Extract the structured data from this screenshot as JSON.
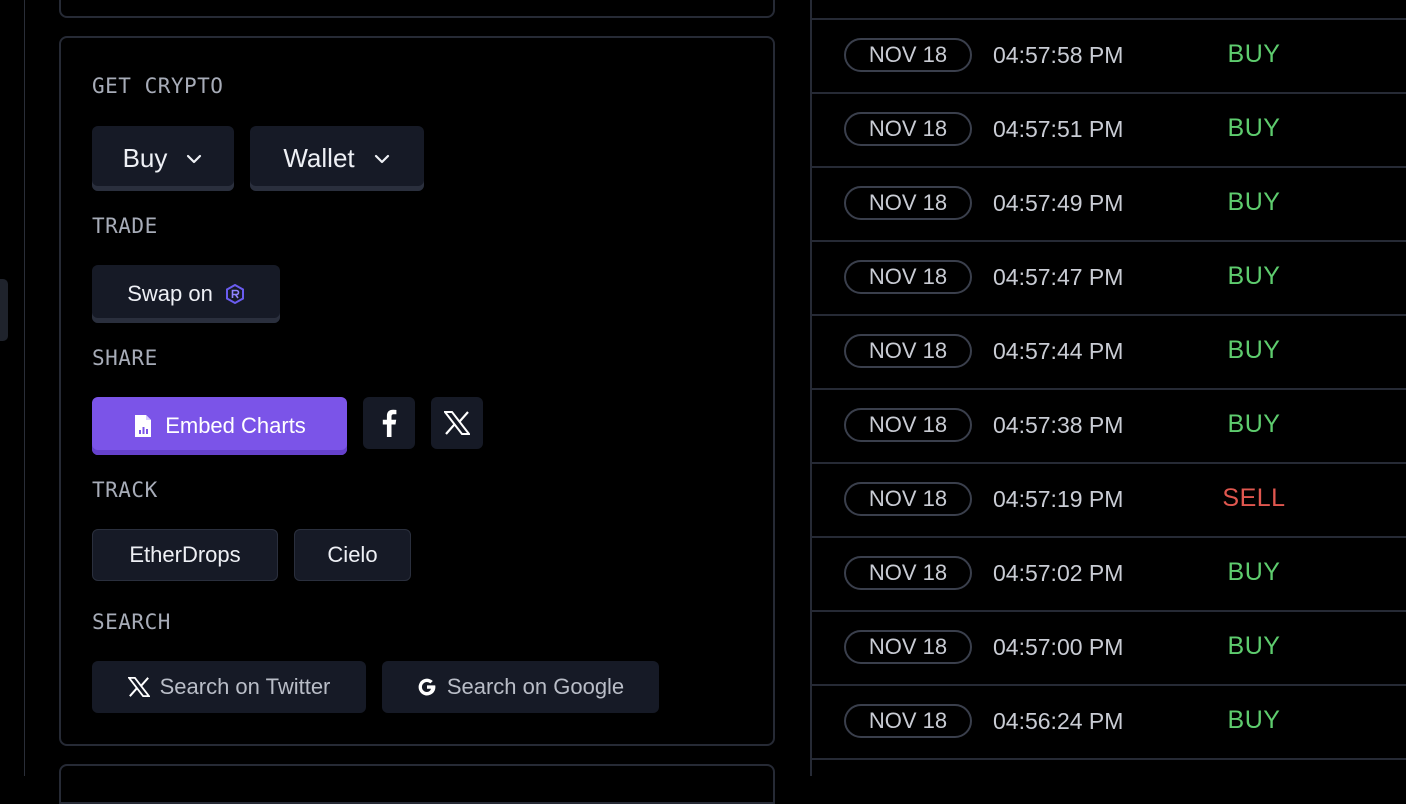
{
  "get_crypto": {
    "label": "GET CRYPTO",
    "buy_dropdown": "Buy",
    "wallet_dropdown": "Wallet"
  },
  "trade": {
    "label": "TRADE",
    "swap_label": "Swap on",
    "swap_icon": "raydium-logo-icon"
  },
  "share": {
    "label": "SHARE",
    "embed_label": "Embed Charts",
    "facebook_icon": "facebook-icon",
    "x_icon": "x-twitter-icon"
  },
  "track": {
    "label": "TRACK",
    "etherdrops": "EtherDrops",
    "cielo": "Cielo"
  },
  "search": {
    "label": "SEARCH",
    "twitter": "Search on Twitter",
    "google": "Search on Google"
  },
  "colors": {
    "accent": "#7b54e8",
    "buy": "#5ecc6e",
    "sell": "#e0574f"
  },
  "trades": [
    {
      "date": "NOV 18",
      "time": "04:57:58 PM",
      "side": "BUY"
    },
    {
      "date": "NOV 18",
      "time": "04:57:51 PM",
      "side": "BUY"
    },
    {
      "date": "NOV 18",
      "time": "04:57:49 PM",
      "side": "BUY"
    },
    {
      "date": "NOV 18",
      "time": "04:57:47 PM",
      "side": "BUY"
    },
    {
      "date": "NOV 18",
      "time": "04:57:44 PM",
      "side": "BUY"
    },
    {
      "date": "NOV 18",
      "time": "04:57:38 PM",
      "side": "BUY"
    },
    {
      "date": "NOV 18",
      "time": "04:57:19 PM",
      "side": "SELL"
    },
    {
      "date": "NOV 18",
      "time": "04:57:02 PM",
      "side": "BUY"
    },
    {
      "date": "NOV 18",
      "time": "04:57:00 PM",
      "side": "BUY"
    },
    {
      "date": "NOV 18",
      "time": "04:56:24 PM",
      "side": "BUY"
    }
  ]
}
